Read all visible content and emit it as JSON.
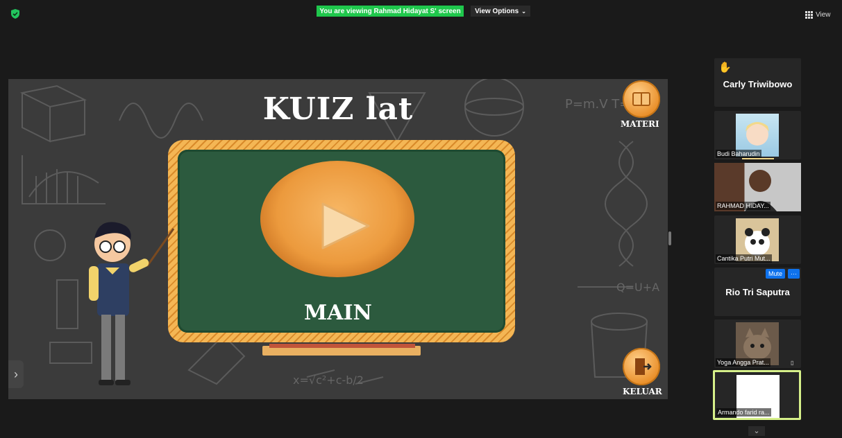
{
  "topbar": {
    "banner": "You are viewing Rahmad Hidayat S' screen",
    "view_options": "View Options",
    "view": "View"
  },
  "share": {
    "title": "KUIZ lat",
    "materi_label": "MATERI",
    "main_label": "MAIN",
    "keluar_label": "KELUAR"
  },
  "participants": {
    "carly": "Carly Triwibowo",
    "budi": "Budi Baharudin",
    "rahmad": "RAHMAD HIDAY...",
    "cantika": "Cantika Putri Mut...",
    "rio": "Rio Tri Saputra",
    "mute": "Mute",
    "more": "···",
    "yoga": "Yoga Angga Prat...",
    "armando": "Armando farid ra..."
  },
  "colors": {
    "banner_green": "#1fc74c",
    "zoom_blue": "#0e72ed",
    "active_speaker_border": "#d6f08a"
  }
}
